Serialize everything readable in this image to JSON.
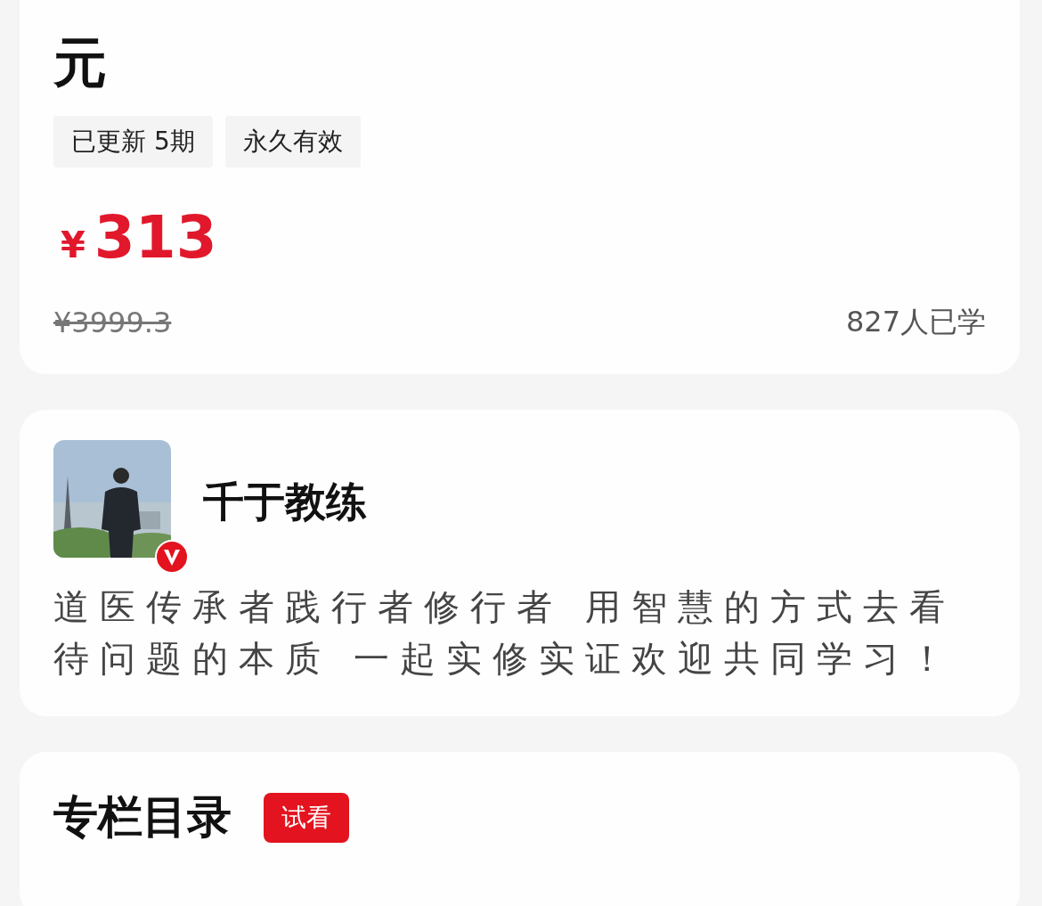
{
  "course": {
    "title": "元",
    "tags": [
      "已更新 5期",
      "永久有效"
    ],
    "price_symbol": "¥",
    "price": "313",
    "original_price": "¥3999.3",
    "learners": "827人已学"
  },
  "teacher": {
    "verified": true,
    "name": "千于教练",
    "bio": "道医传承者践行者修行者 用智慧的方式去看待问题的本质 一起实修实证欢迎共同学习！"
  },
  "catalog": {
    "title": "专栏目录",
    "badge": "试看"
  }
}
